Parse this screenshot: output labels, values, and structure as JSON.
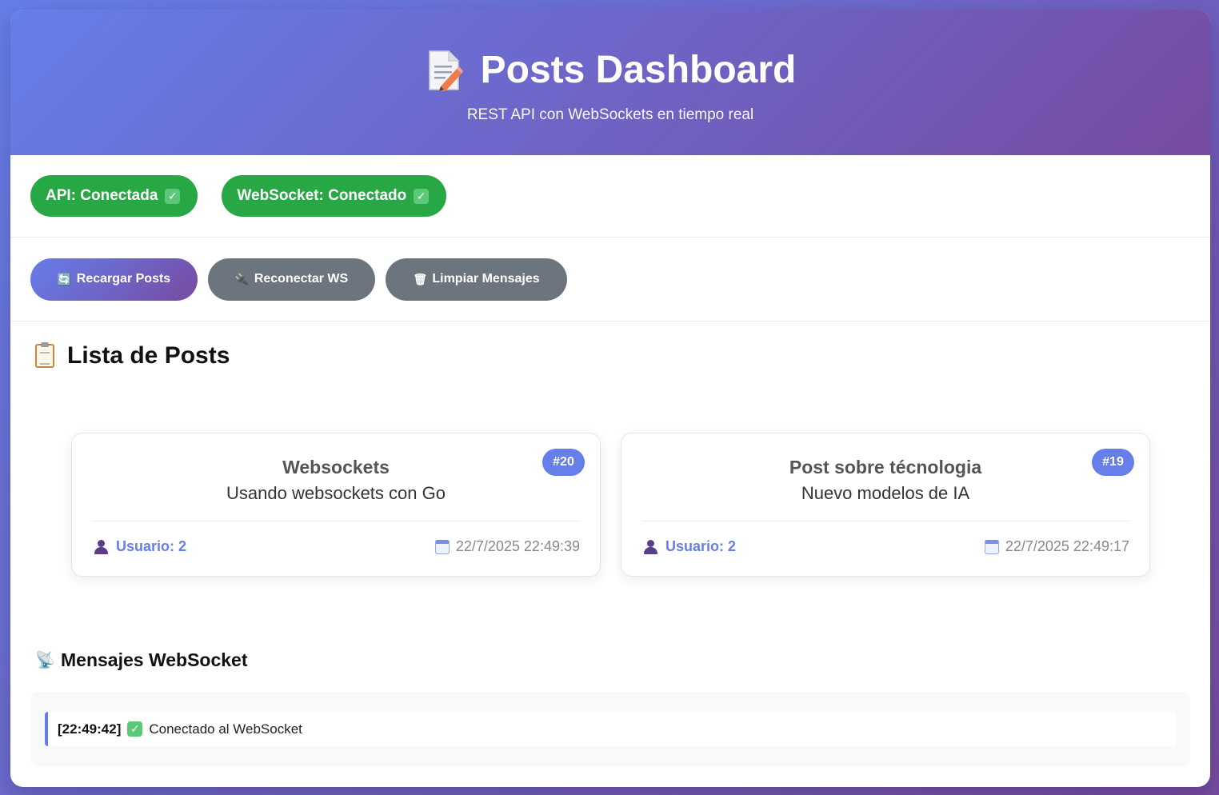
{
  "header": {
    "title": "Posts Dashboard",
    "title_icon": "memo-icon",
    "subtitle": "REST API con WebSockets en tiempo real"
  },
  "status": {
    "api": "API: Conectada",
    "ws": "WebSocket: Conectado",
    "ok_icon": "✓"
  },
  "actions": {
    "reload": {
      "label": "Recargar Posts",
      "icon": "🔄"
    },
    "reconnect": {
      "label": "Reconectar WS",
      "icon": "🔌"
    },
    "clear": {
      "label": "Limpiar Mensajes",
      "icon": "🗑"
    }
  },
  "posts_section": {
    "title": "Lista de Posts",
    "posts": [
      {
        "id": "#20",
        "title": "Websockets",
        "body": "Usando websockets con Go",
        "user": "Usuario: 2",
        "date": "22/7/2025 22:49:39"
      },
      {
        "id": "#19",
        "title": "Post sobre técnologia",
        "body": "Nuevo modelos de IA",
        "user": "Usuario: 2",
        "date": "22/7/2025 22:49:17"
      }
    ]
  },
  "ws_section": {
    "title": "Mensajes WebSocket",
    "messages": [
      {
        "time": "[22:49:42]",
        "text": "Conectado al WebSocket"
      }
    ]
  },
  "colors": {
    "brand_start": "#667eea",
    "brand_end": "#764ba2",
    "success": "#28a745",
    "secondary": "#6c757d"
  }
}
